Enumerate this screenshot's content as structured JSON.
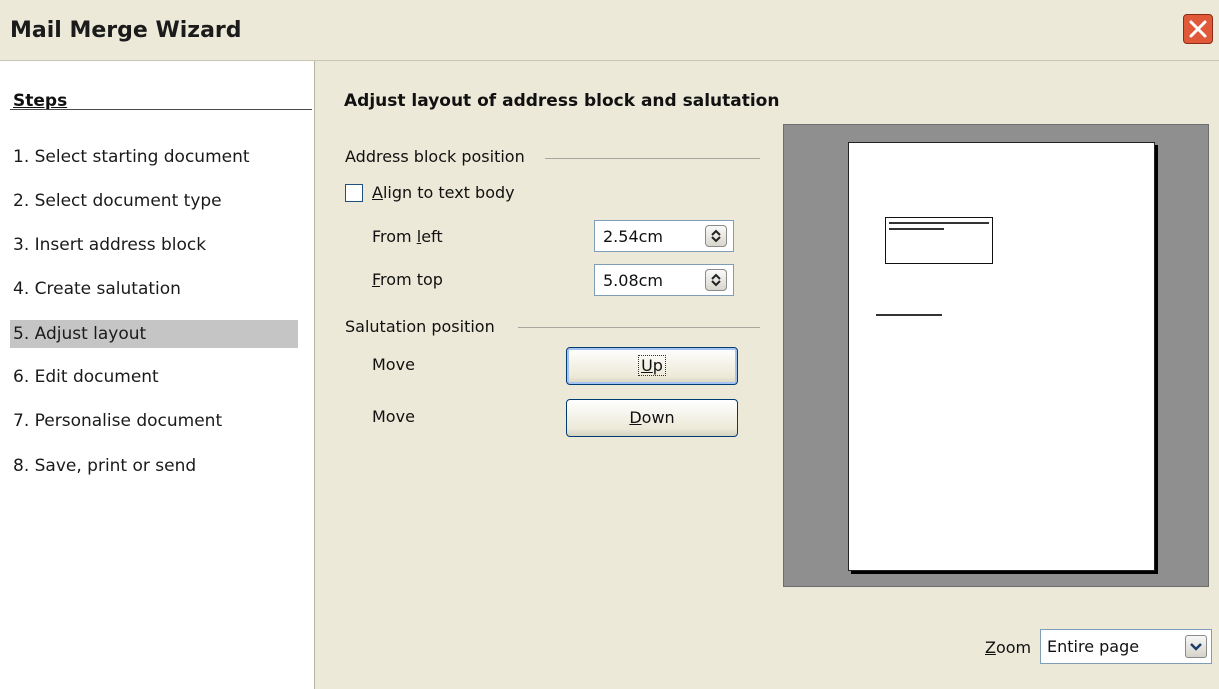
{
  "window": {
    "title": "Mail Merge Wizard"
  },
  "icons": {
    "close": "close-icon",
    "spin": "spinner-icon",
    "dropdown": "chevron-down-icon"
  },
  "steps": {
    "heading": "Steps",
    "items": [
      {
        "label": "1.  Select starting document"
      },
      {
        "label": "2.  Select document type"
      },
      {
        "label": "3.  Insert address block"
      },
      {
        "label": "4.  Create salutation"
      },
      {
        "label": "5.  Adjust layout"
      },
      {
        "label": "6.  Edit document"
      },
      {
        "label": "7.  Personalise document"
      },
      {
        "label": "8.  Save, print or send"
      }
    ],
    "active_index": 4
  },
  "main": {
    "heading": "Adjust layout of address block and salutation",
    "address_block": {
      "group_label": "Address block position",
      "align_checkbox": {
        "label_u": "A",
        "label_rest": "lign to text body",
        "checked": false
      },
      "from_left": {
        "label_pre": "From ",
        "label_u": "l",
        "label_post": "eft",
        "value": "2.54cm"
      },
      "from_top": {
        "label_u": "F",
        "label_post": "rom top",
        "value": "5.08cm"
      }
    },
    "salutation": {
      "group_label": "Salutation position",
      "move_up_label": "Move",
      "move_down_label": "Move",
      "up_button": {
        "label_u": "U",
        "label_rest": "p"
      },
      "down_button": {
        "label_u": "D",
        "label_rest": "own"
      }
    },
    "zoom": {
      "label_u": "Z",
      "label_rest": "oom",
      "value": "Entire page"
    }
  },
  "colors": {
    "dialog_bg": "#ece9d8",
    "active_step": "#c5c5c5",
    "preview_bg": "#8f8f8f",
    "close": "#e05a3a"
  }
}
